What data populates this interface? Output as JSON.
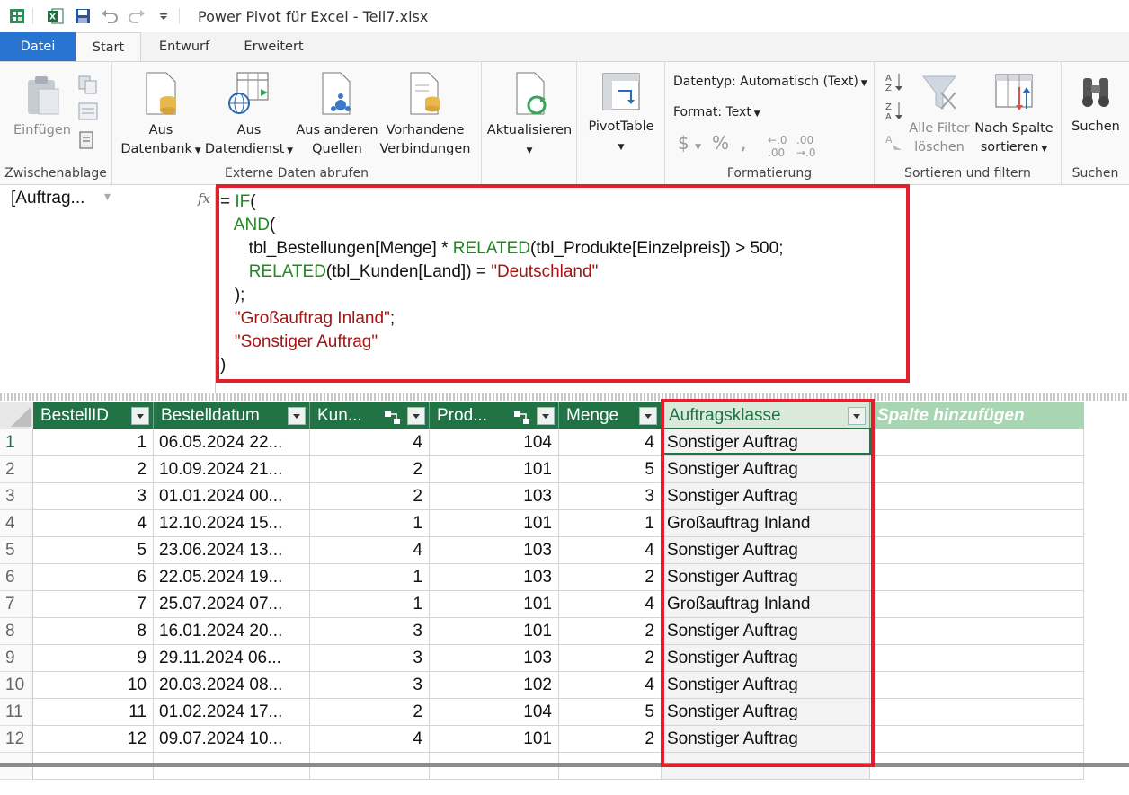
{
  "titlebar": {
    "title": "Power Pivot für Excel - Teil7.xlsx"
  },
  "tabs": [
    {
      "label": "Datei"
    },
    {
      "label": "Start"
    },
    {
      "label": "Entwurf"
    },
    {
      "label": "Erweitert"
    }
  ],
  "ribbon": {
    "clipboard": {
      "paste": "Einfügen",
      "label": "Zwischenablage"
    },
    "external": {
      "from_db_1": "Aus",
      "from_db_2": "Datenbank",
      "from_service_1": "Aus",
      "from_service_2": "Datendienst",
      "other_1": "Aus anderen",
      "other_2": "Quellen",
      "existing_1": "Vorhandene",
      "existing_2": "Verbindungen",
      "label": "Externe Daten abrufen"
    },
    "refresh": {
      "label": "Aktualisieren"
    },
    "pivot": {
      "label": "PivotTable"
    },
    "formatting": {
      "datatype": "Datentyp: Automatisch (Text)",
      "format": "Format: Text",
      "label": "Formatierung"
    },
    "sort": {
      "clear_1": "Alle Filter",
      "clear_2": "löschen",
      "bycol_1": "Nach Spalte",
      "bycol_2": "sortieren",
      "label": "Sortieren und filtern"
    },
    "find": {
      "button": "Suchen",
      "label": "Suchen"
    }
  },
  "formulabar": {
    "namebox": "[Auftrag...",
    "fx": "fx",
    "lines": [
      [
        {
          "t": "= ",
          "c": "bl"
        },
        {
          "t": "IF",
          "c": "kw"
        },
        {
          "t": "(",
          "c": "bl"
        }
      ],
      [
        {
          "t": "   ",
          "c": "bl"
        },
        {
          "t": "AND",
          "c": "kw"
        },
        {
          "t": "(",
          "c": "bl"
        }
      ],
      [
        {
          "t": "      tbl_Bestellungen[Menge] * ",
          "c": "bl"
        },
        {
          "t": "RELATED",
          "c": "kw"
        },
        {
          "t": "(tbl_Produkte[Einzelpreis]) > 500;",
          "c": "bl"
        }
      ],
      [
        {
          "t": "      ",
          "c": "bl"
        },
        {
          "t": "RELATED",
          "c": "kw"
        },
        {
          "t": "(tbl_Kunden[Land]) = ",
          "c": "bl"
        },
        {
          "t": "\"Deutschland\"",
          "c": "st"
        }
      ],
      [
        {
          "t": "   );",
          "c": "bl"
        }
      ],
      [
        {
          "t": "   ",
          "c": "bl"
        },
        {
          "t": "\"Großauftrag Inland\"",
          "c": "st"
        },
        {
          "t": ";",
          "c": "bl"
        }
      ],
      [
        {
          "t": "   ",
          "c": "bl"
        },
        {
          "t": "\"Sonstiger Auftrag\"",
          "c": "st"
        }
      ],
      [
        {
          "t": ")",
          "c": "bl"
        }
      ]
    ]
  },
  "table": {
    "columns": [
      {
        "label": "BestellID"
      },
      {
        "label": "Bestelldatum"
      },
      {
        "label": "Kun..."
      },
      {
        "label": "Prod..."
      },
      {
        "label": "Menge"
      },
      {
        "label": "Auftragsklasse"
      },
      {
        "label": "Spalte hinzufügen"
      }
    ],
    "rows": [
      {
        "n": "1",
        "id": "1",
        "date": "06.05.2024 22...",
        "kun": "4",
        "prod": "104",
        "menge": "4",
        "ak": "Sonstiger Auftrag"
      },
      {
        "n": "2",
        "id": "2",
        "date": "10.09.2024 21...",
        "kun": "2",
        "prod": "101",
        "menge": "5",
        "ak": "Sonstiger Auftrag"
      },
      {
        "n": "3",
        "id": "3",
        "date": "01.01.2024 00...",
        "kun": "2",
        "prod": "103",
        "menge": "3",
        "ak": "Sonstiger Auftrag"
      },
      {
        "n": "4",
        "id": "4",
        "date": "12.10.2024 15...",
        "kun": "1",
        "prod": "101",
        "menge": "1",
        "ak": "Großauftrag Inland"
      },
      {
        "n": "5",
        "id": "5",
        "date": "23.06.2024 13...",
        "kun": "4",
        "prod": "103",
        "menge": "4",
        "ak": "Sonstiger Auftrag"
      },
      {
        "n": "6",
        "id": "6",
        "date": "22.05.2024 19...",
        "kun": "1",
        "prod": "103",
        "menge": "2",
        "ak": "Sonstiger Auftrag"
      },
      {
        "n": "7",
        "id": "7",
        "date": "25.07.2024 07...",
        "kun": "1",
        "prod": "101",
        "menge": "4",
        "ak": "Großauftrag Inland"
      },
      {
        "n": "8",
        "id": "8",
        "date": "16.01.2024 20...",
        "kun": "3",
        "prod": "101",
        "menge": "2",
        "ak": "Sonstiger Auftrag"
      },
      {
        "n": "9",
        "id": "9",
        "date": "29.11.2024 06...",
        "kun": "3",
        "prod": "103",
        "menge": "2",
        "ak": "Sonstiger Auftrag"
      },
      {
        "n": "10",
        "id": "10",
        "date": "20.03.2024 08...",
        "kun": "3",
        "prod": "102",
        "menge": "4",
        "ak": "Sonstiger Auftrag"
      },
      {
        "n": "11",
        "id": "11",
        "date": "01.02.2024 17...",
        "kun": "2",
        "prod": "104",
        "menge": "5",
        "ak": "Sonstiger Auftrag"
      },
      {
        "n": "12",
        "id": "12",
        "date": "09.07.2024 10...",
        "kun": "4",
        "prod": "101",
        "menge": "2",
        "ak": "Sonstiger Auftrag"
      }
    ]
  },
  "colors": {
    "header_green": "#217346",
    "highlight_red": "#e0202a",
    "keyword_green": "#1f8a1f",
    "string_red": "#a31515"
  }
}
